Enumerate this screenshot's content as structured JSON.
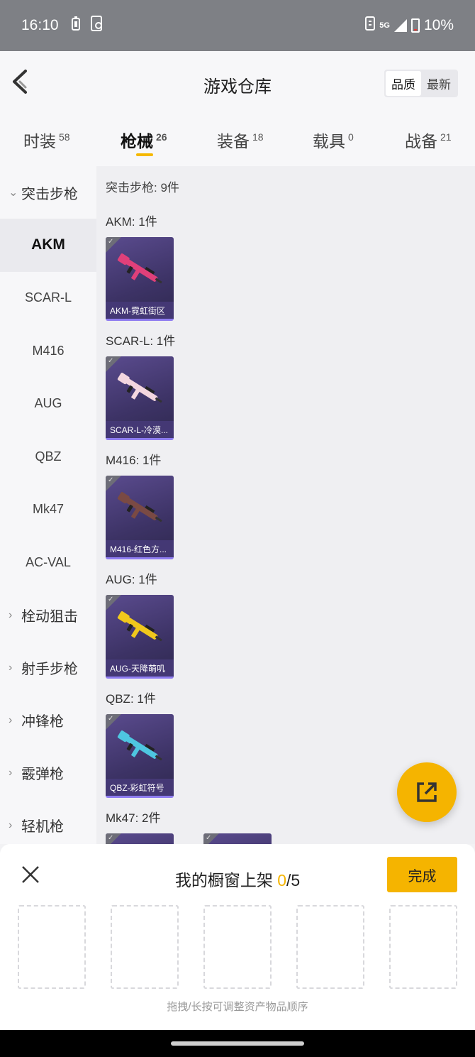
{
  "status_bar": {
    "time": "16:10",
    "network": "5G",
    "battery": "10%"
  },
  "header": {
    "title": "游戏仓库",
    "sort_options": [
      "品质",
      "最新"
    ]
  },
  "tabs": [
    {
      "label": "时装",
      "count": "58"
    },
    {
      "label": "枪械",
      "count": "26"
    },
    {
      "label": "装备",
      "count": "18"
    },
    {
      "label": "载具",
      "count": "0"
    },
    {
      "label": "战备",
      "count": "21"
    }
  ],
  "sidebar": {
    "expanded_category": "突击步枪",
    "subitems": [
      "AKM",
      "SCAR-L",
      "M416",
      "AUG",
      "QBZ",
      "Mk47",
      "AC-VAL"
    ],
    "categories": [
      "栓动狙击",
      "射手步枪",
      "冲锋枪",
      "霰弹枪",
      "轻机枪"
    ]
  },
  "content": {
    "group_header": "突击步枪: 9件",
    "sections": [
      {
        "title": "AKM: 1件",
        "items": [
          {
            "label": "AKM-霓虹街区",
            "gun_color": "#e0407a"
          }
        ]
      },
      {
        "title": "SCAR-L: 1件",
        "items": [
          {
            "label": "SCAR-L-冷漠...",
            "gun_color": "#f3d6df"
          }
        ]
      },
      {
        "title": "M416: 1件",
        "items": [
          {
            "label": "M416-红色方...",
            "gun_color": "#7a4a44"
          }
        ]
      },
      {
        "title": "AUG: 1件",
        "items": [
          {
            "label": "AUG-天降萌叽",
            "gun_color": "#f0c81c"
          }
        ]
      },
      {
        "title": "QBZ: 1件",
        "items": [
          {
            "label": "QBZ-彩虹符号",
            "gun_color": "#4ec6e0"
          }
        ]
      },
      {
        "title": "Mk47: 2件",
        "items": [
          {
            "label": "",
            "gun_color": "#555"
          },
          {
            "label": "",
            "gun_color": "#555"
          }
        ]
      }
    ]
  },
  "panel": {
    "title_prefix": "我的橱窗上架 ",
    "count": "0",
    "total": "/5",
    "done_label": "完成",
    "hint": "拖拽/长按可调整资产物品顺序"
  },
  "colors": {
    "accent": "#f5b400",
    "card_bg": "#3d3366"
  }
}
